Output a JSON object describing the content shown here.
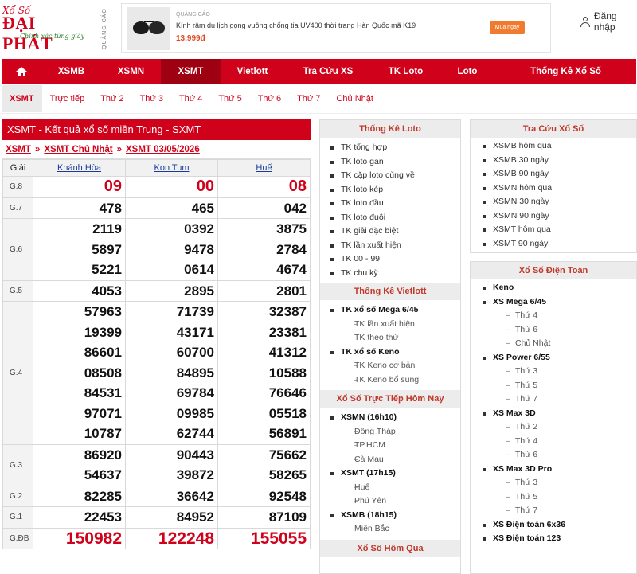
{
  "header": {
    "logo_top": "Xổ Số",
    "logo_main": "ĐẠI PHÁT",
    "logo_tagline": "Chính xác từng giây",
    "ad_vertical_label": "QUẢNG CÁO",
    "ad_label": "QUẢNG CÁO",
    "ad_title": "Kính râm du lịch gọng vuông chống tia UV400 thời trang Hàn Quốc mã K19",
    "ad_price": "13.999đ",
    "ad_button": "Mua ngay",
    "login": "Đăng nhập"
  },
  "nav": {
    "items": [
      "XSMB",
      "XSMN",
      "XSMT",
      "Vietlott",
      "Tra Cứu XS",
      "TK Loto",
      "Loto",
      "Thống Kê Xổ Số"
    ]
  },
  "subnav": {
    "items": [
      "XSMT",
      "Trực tiếp",
      "Thứ 2",
      "Thứ 3",
      "Thứ 4",
      "Thứ 5",
      "Thứ 6",
      "Thứ 7",
      "Chủ Nhật"
    ]
  },
  "results": {
    "heading": "XSMT - Kết quả xổ số miền Trung - SXMT",
    "breadcrumb": [
      "XSMT",
      "XSMT Chủ Nhật",
      "XSMT 03/05/2026"
    ],
    "col_label": "Giải",
    "provinces": [
      "Khánh Hòa",
      "Kon Tum",
      "Huế"
    ],
    "rows": [
      {
        "label": "G.8",
        "values": [
          [
            "09"
          ],
          [
            "00"
          ],
          [
            "08"
          ]
        ]
      },
      {
        "label": "G.7",
        "values": [
          [
            "478"
          ],
          [
            "465"
          ],
          [
            "042"
          ]
        ]
      },
      {
        "label": "G.6",
        "values": [
          [
            "2119",
            "5897",
            "5221"
          ],
          [
            "0392",
            "9478",
            "0614"
          ],
          [
            "3875",
            "2784",
            "4674"
          ]
        ]
      },
      {
        "label": "G.5",
        "values": [
          [
            "4053"
          ],
          [
            "2895"
          ],
          [
            "2801"
          ]
        ]
      },
      {
        "label": "G.4",
        "values": [
          [
            "57963",
            "19399",
            "86601",
            "08508",
            "84531",
            "97071",
            "10787"
          ],
          [
            "71739",
            "43171",
            "60700",
            "84895",
            "69784",
            "09985",
            "62744"
          ],
          [
            "32387",
            "23381",
            "41312",
            "10588",
            "76646",
            "05518",
            "56891"
          ]
        ]
      },
      {
        "label": "G.3",
        "values": [
          [
            "86920",
            "54637"
          ],
          [
            "90443",
            "39872"
          ],
          [
            "75662",
            "58265"
          ]
        ]
      },
      {
        "label": "G.2",
        "values": [
          [
            "82285"
          ],
          [
            "36642"
          ],
          [
            "92548"
          ]
        ]
      },
      {
        "label": "G.1",
        "values": [
          [
            "22453"
          ],
          [
            "84952"
          ],
          [
            "87109"
          ]
        ]
      },
      {
        "label": "G.ĐB",
        "values": [
          [
            "150982"
          ],
          [
            "122248"
          ],
          [
            "155055"
          ]
        ]
      }
    ]
  },
  "mid_panel": {
    "loto_title": "Thống Kê Loto",
    "loto_items": [
      "TK tổng hợp",
      "TK loto gan",
      "TK cặp loto cùng về",
      "TK loto kép",
      "TK loto đầu",
      "TK loto đuôi",
      "TK giải đặc biệt",
      "TK lần xuất hiện",
      "TK 00 - 99",
      "TK chu kỳ"
    ],
    "vietlott_title": "Thống Kê Vietlott",
    "vietlott_mega": "TK xổ số Mega 6/45",
    "vietlott_mega_subs": [
      "TK lần xuất hiện",
      "TK theo thứ"
    ],
    "vietlott_keno": "TK xổ số Keno",
    "vietlott_keno_subs": [
      "TK Keno cơ bản",
      "TK Keno bổ sung"
    ],
    "live_title": "Xổ Số Trực Tiếp Hôm Nay",
    "live_xsmn": "XSMN (16h10)",
    "live_xsmn_subs": [
      "Đồng Tháp",
      "TP.HCM",
      "Cà Mau"
    ],
    "live_xsmt": "XSMT (17h15)",
    "live_xsmt_subs": [
      "Huế",
      "Phú Yên"
    ],
    "live_xsmb": "XSMB (18h15)",
    "live_xsmb_subs": [
      "Miền Bắc"
    ],
    "today_title": "Xổ Số Hôm Qua"
  },
  "right_panel": {
    "lookup_title": "Tra Cứu Xổ Số",
    "lookup_items": [
      "XSMB hôm qua",
      "XSMB 30 ngày",
      "XSMB 90 ngày",
      "XSMN hôm qua",
      "XSMN 30 ngày",
      "XSMN 90 ngày",
      "XSMT hôm qua",
      "XSMT 90 ngày"
    ],
    "computer_title": "Xổ Số Điện Toán",
    "keno": "Keno",
    "mega": "XS Mega 6/45",
    "mega_subs": [
      "Thứ 4",
      "Thứ 6",
      "Chủ Nhật"
    ],
    "power": "XS Power 6/55",
    "power_subs": [
      "Thứ 3",
      "Thứ 5",
      "Thứ 7"
    ],
    "max3d": "XS Max 3D",
    "max3d_subs": [
      "Thứ 2",
      "Thứ 4",
      "Thứ 6"
    ],
    "max3dpro": "XS Max 3D Pro",
    "max3dpro_subs": [
      "Thứ 3",
      "Thứ 5",
      "Thứ 7"
    ],
    "dt6x36": "XS Điện toán 6x36",
    "dt123": "XS Điện toán 123"
  }
}
